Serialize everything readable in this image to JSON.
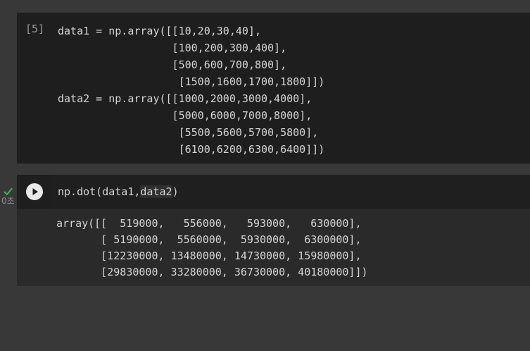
{
  "cell1": {
    "execution_count": "[5]",
    "code": "data1 = np.array([[10,20,30,40],\n                  [100,200,300,400],\n                  [500,600,700,800],\n                   [1500,1600,1700,1800]])\ndata2 = np.array([[1000,2000,3000,4000],\n                  [5000,6000,7000,8000],\n                   [5500,5600,5700,5800],\n                   [6100,6200,6300,6400]])"
  },
  "cell2": {
    "code_prefix": "np.dot(data1,",
    "code_highlight": "data2",
    "code_suffix": ")",
    "status_icon": "check-icon",
    "elapsed": "0초",
    "output": "array([[  519000,   556000,   593000,   630000],\n       [ 5190000,  5560000,  5930000,  6300000],\n       [12230000, 13480000, 14730000, 15980000],\n       [29830000, 33280000, 36730000, 40180000]])"
  },
  "colors": {
    "background": "#383838",
    "cell": "#1e1e1e",
    "output": "#2a2a2a",
    "check": "#4caf50"
  }
}
